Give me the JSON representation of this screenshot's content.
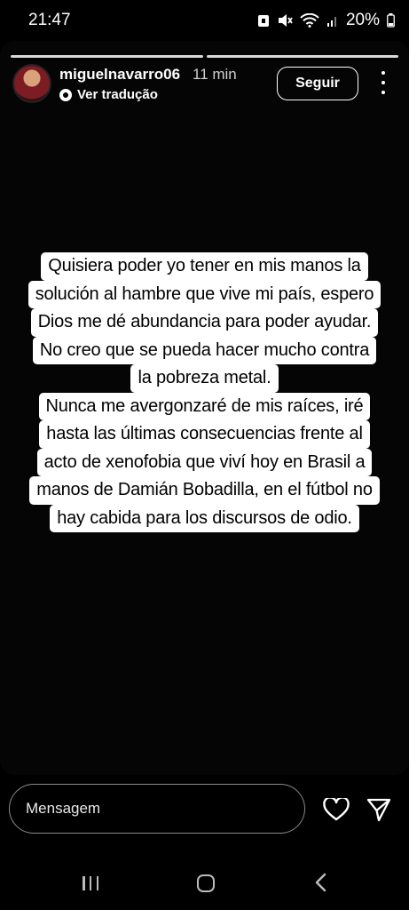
{
  "status_bar": {
    "time": "21:47",
    "battery": "20%"
  },
  "story": {
    "username": "miguelnavarro06",
    "time_ago": "11 min",
    "translate_label": "Ver tradução",
    "follow_label": "Seguir",
    "segments": 2
  },
  "caption": {
    "lines": [
      "Quisiera poder yo tener en mis manos la",
      "solución al hambre que vive mi país, espero",
      "Dios me dé abundancia para poder ayudar.",
      "No creo que se pueda hacer mucho contra",
      "la pobreza metal.",
      "Nunca me avergonzaré de mis raíces, iré",
      "hasta las últimas consecuencias frente al",
      "acto de xenofobia que viví hoy en Brasil a",
      "manos de Damián Bobadilla, en el fútbol no",
      "hay cabida para los discursos de odio."
    ]
  },
  "message_bar": {
    "placeholder": "Mensagem"
  },
  "icons": {
    "heart": "heart-icon",
    "send": "send-icon",
    "more": "more-options-icon"
  }
}
